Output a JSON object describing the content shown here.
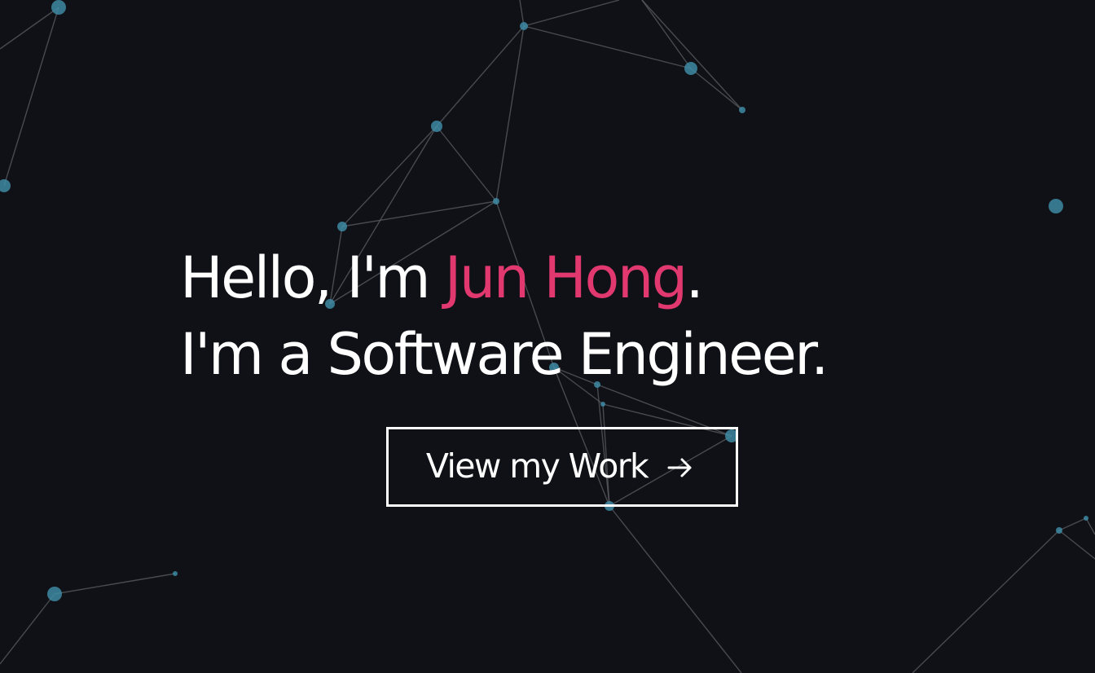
{
  "hero": {
    "line1": {
      "prefix": "Hello, I'm ",
      "name": "Jun Hong",
      "suffix": "."
    },
    "line2": "I'm a Software Engineer.",
    "cta_label": "View my Work",
    "cta_icon": "arrow-right-icon",
    "accent_color": "#e0386f",
    "background_color": "#101116",
    "node_color": "#3f8ea8"
  }
}
